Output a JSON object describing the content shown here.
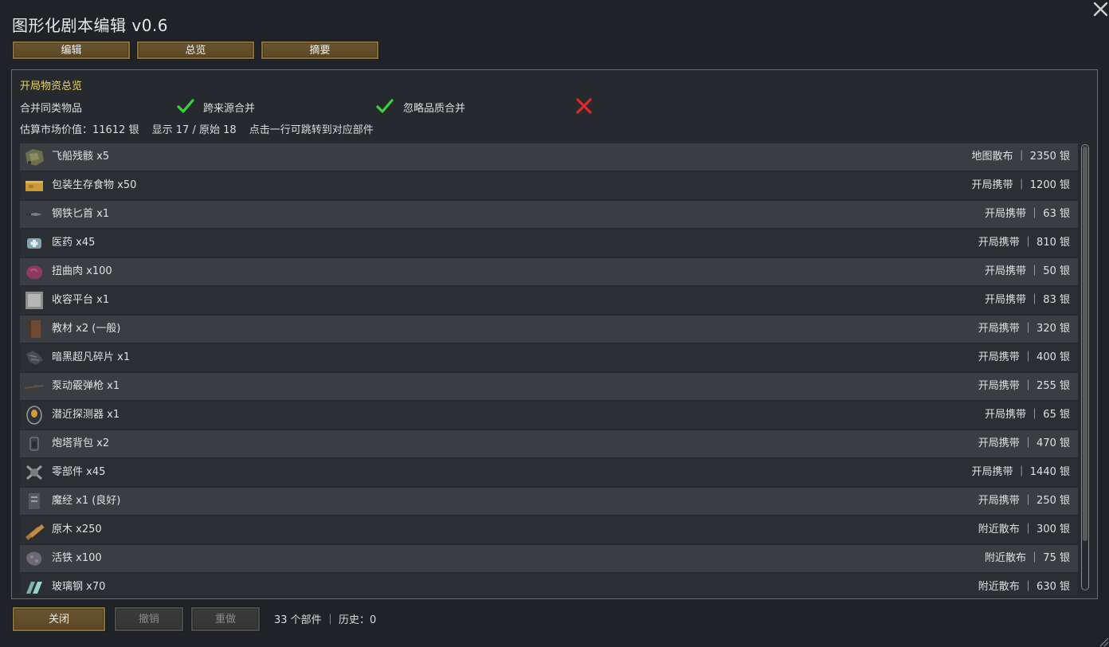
{
  "window": {
    "title": "图形化剧本编辑  v0.6",
    "close_icon": "close-icon"
  },
  "tabs": [
    {
      "label": "编辑"
    },
    {
      "label": "总览"
    },
    {
      "label": "摘要"
    }
  ],
  "panel": {
    "section_title": "开局物资总览",
    "options": [
      {
        "label": "合并同类物品",
        "state": "checked"
      },
      {
        "label": "跨来源合并",
        "state": "checked"
      },
      {
        "label": "忽略品质合并",
        "state": "unchecked"
      }
    ],
    "summary": {
      "market_value": "估算市场价值：11612 银",
      "shown": "显示 17 / 原始 18",
      "hint": "点击一行可跳转到对应部件"
    },
    "items": [
      {
        "name": "飞船残骸 x5",
        "meta": "地图散布 ｜ 2350 银",
        "icon": "ship-chunk-icon"
      },
      {
        "name": "包装生存食物 x50",
        "meta": "开局携带 ｜ 1200 银",
        "icon": "survival-meal-icon"
      },
      {
        "name": "钢铁匕首 x1",
        "meta": "开局携带 ｜ 63 银",
        "icon": "knife-icon"
      },
      {
        "name": "医药 x45",
        "meta": "开局携带 ｜ 810 银",
        "icon": "medicine-icon"
      },
      {
        "name": "扭曲肉 x100",
        "meta": "开局携带 ｜ 50 银",
        "icon": "twisted-meat-icon"
      },
      {
        "name": "收容平台 x1",
        "meta": "开局携带 ｜ 83 银",
        "icon": "holding-platform-icon"
      },
      {
        "name": "教材 x2 (一般)",
        "meta": "开局携带 ｜ 320 银",
        "icon": "book-icon"
      },
      {
        "name": "暗黑超凡碎片 x1",
        "meta": "开局携带 ｜ 400 银",
        "icon": "shard-icon"
      },
      {
        "name": "泵动霰弹枪 x1",
        "meta": "开局携带 ｜ 255 银",
        "icon": "shotgun-icon"
      },
      {
        "name": "潜近探测器 x1",
        "meta": "开局携带 ｜ 65 银",
        "icon": "detector-icon"
      },
      {
        "name": "炮塔背包 x2",
        "meta": "开局携带 ｜ 470 银",
        "icon": "turret-pack-icon"
      },
      {
        "name": "零部件 x45",
        "meta": "开局携带 ｜ 1440 银",
        "icon": "components-icon"
      },
      {
        "name": "魔经 x1 (良好)",
        "meta": "开局携带 ｜ 250 银",
        "icon": "tome-icon"
      },
      {
        "name": "原木 x250",
        "meta": "附近散布 ｜ 300 银",
        "icon": "wood-log-icon"
      },
      {
        "name": "活铁 x100",
        "meta": "附近散布 ｜ 75 银",
        "icon": "bioferrite-icon"
      },
      {
        "name": "玻璃钢 x70",
        "meta": "附近散布 ｜ 630 银",
        "icon": "glitterworld-steel-icon"
      }
    ]
  },
  "footer": {
    "close_label": "关闭",
    "undo_label": "撤销",
    "redo_label": "重做",
    "status": "33 个部件 ｜ 历史：0"
  },
  "colors": {
    "background": "#1f2328",
    "button_brown": "#6b5630",
    "section_title": "#e8d46a",
    "check_green": "#3cd13c",
    "cross_red": "#e02828"
  }
}
